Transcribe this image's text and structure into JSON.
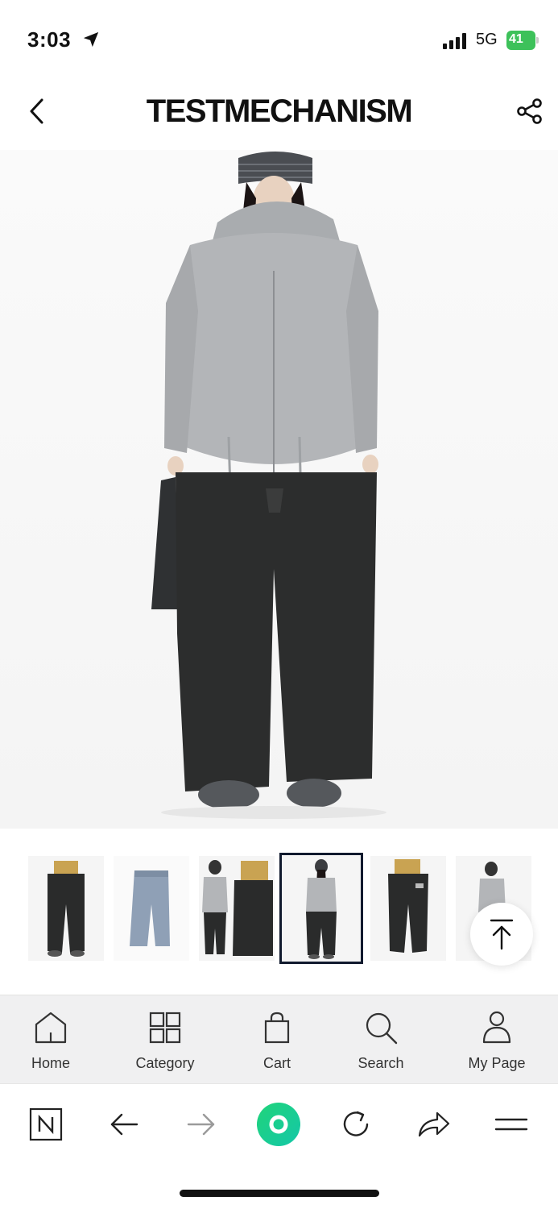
{
  "status": {
    "time": "3:03",
    "network": "5G",
    "battery": "41"
  },
  "header": {
    "brand": "TESTMECHANISM"
  },
  "colors": {
    "accent_green": "#1ed17a",
    "battery_green": "#3dc15a",
    "active_thumb_border": "#111a2e"
  },
  "nav": {
    "items": [
      {
        "label": "Home",
        "icon": "home-icon"
      },
      {
        "label": "Category",
        "icon": "grid-icon"
      },
      {
        "label": "Cart",
        "icon": "bag-icon"
      },
      {
        "label": "Search",
        "icon": "search-icon"
      },
      {
        "label": "My Page",
        "icon": "person-icon"
      }
    ]
  },
  "browser": {
    "buttons": [
      "naver-logo",
      "back-arrow-icon",
      "forward-arrow-icon",
      "green-dot-home",
      "refresh-icon",
      "share-arrow-icon",
      "menu-icon"
    ]
  }
}
